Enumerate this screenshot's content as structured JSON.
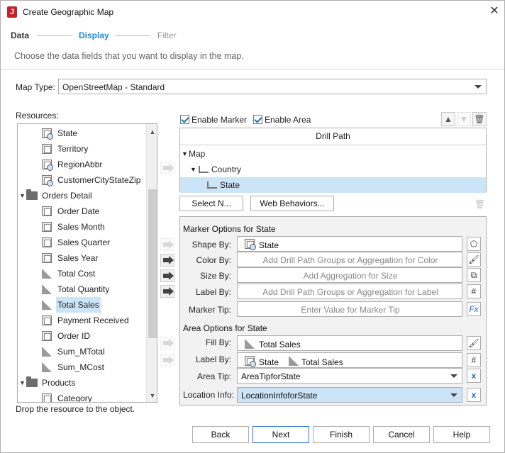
{
  "window": {
    "title": "Create Geographic Map",
    "app_icon": "J"
  },
  "steps": [
    {
      "label": "Data",
      "state": "done",
      "color": "#333333"
    },
    {
      "label": "Display",
      "state": "active",
      "color": "#1a8ad4"
    },
    {
      "label": "Filter",
      "state": "pending",
      "color": "#9a9a9a"
    }
  ],
  "instruction": "Choose the data fields that you want to display in the map.",
  "map_type": {
    "label": "Map Type:",
    "value": "OpenStreetMap - Standard"
  },
  "resources": {
    "label": "Resources:",
    "hint": "Drop the resource to the object.",
    "items": [
      {
        "label": "State",
        "icon": "geo-dimension-icon",
        "level": 2
      },
      {
        "label": "Territory",
        "icon": "dimension-icon",
        "level": 2
      },
      {
        "label": "RegionAbbr",
        "icon": "geo-dimension-icon",
        "level": 2
      },
      {
        "label": "CustomerCityStateZip",
        "icon": "geo-dimension-icon",
        "level": 2
      },
      {
        "label": "Orders Detail",
        "icon": "folder-icon",
        "level": 1,
        "expanded": true
      },
      {
        "label": "Order Date",
        "icon": "dimension-icon",
        "level": 2
      },
      {
        "label": "Sales Month",
        "icon": "dimension-icon",
        "level": 2
      },
      {
        "label": "Sales Quarter",
        "icon": "dimension-icon",
        "level": 2
      },
      {
        "label": "Sales Year",
        "icon": "dimension-icon",
        "level": 2
      },
      {
        "label": "Total Cost",
        "icon": "measure-icon",
        "level": 2
      },
      {
        "label": "Total Quantity",
        "icon": "measure-icon",
        "level": 2
      },
      {
        "label": "Total Sales",
        "icon": "measure-icon",
        "level": 2,
        "selected": true
      },
      {
        "label": "Payment Received",
        "icon": "dimension-icon",
        "level": 2
      },
      {
        "label": "Order ID",
        "icon": "dimension-icon",
        "level": 2
      },
      {
        "label": "Sum_MTotal",
        "icon": "measure-icon",
        "level": 2
      },
      {
        "label": "Sum_MCost",
        "icon": "measure-icon",
        "level": 2
      },
      {
        "label": "Products",
        "icon": "folder-icon",
        "level": 1,
        "expanded": true
      },
      {
        "label": "Category",
        "icon": "dimension-icon",
        "level": 2
      }
    ]
  },
  "enable_marker": {
    "label": "Enable Marker",
    "checked": true
  },
  "enable_area": {
    "label": "Enable Area",
    "checked": true
  },
  "drill_path": {
    "header": "Drill Path",
    "rows": [
      {
        "label": "Map",
        "level": 0
      },
      {
        "label": "Country",
        "level": 1
      },
      {
        "label": "State",
        "level": 2,
        "selected": true
      }
    ]
  },
  "buttons": {
    "select": "Select N...",
    "web_behaviors": "Web Behaviors..."
  },
  "marker_options": {
    "title": "Marker Options for State",
    "shape_by": {
      "label": "Shape By:",
      "value": "State"
    },
    "color_by": {
      "label": "Color By:",
      "placeholder": "Add Drill Path Groups or Aggregation for Color"
    },
    "size_by": {
      "label": "Size By:",
      "placeholder": "Add Aggregation for Size"
    },
    "label_by": {
      "label": "Label By:",
      "placeholder": "Add Drill Path Groups or Aggregation for Label"
    },
    "marker_tip": {
      "label": "Marker Tip:",
      "placeholder": "Enter Value for Marker Tip"
    }
  },
  "area_options": {
    "title": "Area Options for State",
    "fill_by": {
      "label": "Fill By:",
      "value": "Total Sales"
    },
    "label_by": {
      "label": "Label By:",
      "values": [
        "State",
        "Total Sales"
      ]
    },
    "area_tip": {
      "label": "Area Tip:",
      "value": "AreaTipforState"
    }
  },
  "location_info": {
    "label": "Location Info:",
    "value": "LocationInfoforState"
  },
  "footer": {
    "back": "Back",
    "next": "Next",
    "finish": "Finish",
    "cancel": "Cancel",
    "help": "Help"
  }
}
